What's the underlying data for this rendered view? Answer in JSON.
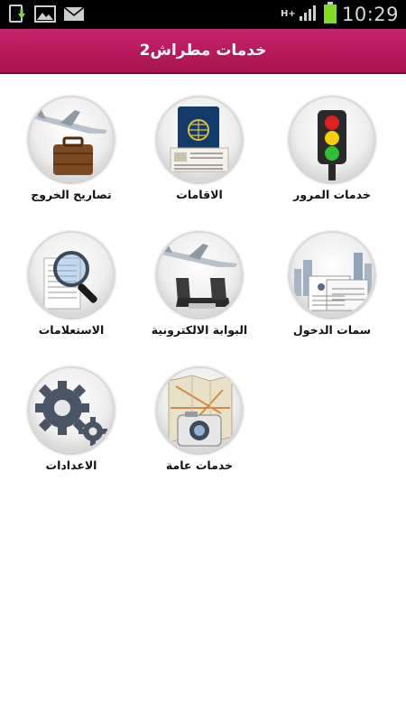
{
  "status_bar": {
    "time": "10:29",
    "network": "H+",
    "icons": [
      "download-icon",
      "gallery-icon",
      "mail-icon",
      "signal-icon",
      "battery-icon"
    ]
  },
  "header": {
    "title": "خدمات مطراش2"
  },
  "colors": {
    "header": "#b4185a",
    "battery": "#7fdc1e"
  },
  "grid": {
    "items": [
      {
        "label": "خدمات المرور",
        "icon": "traffic-light-icon"
      },
      {
        "label": "الاقامات",
        "icon": "passport-icon"
      },
      {
        "label": "تصاريح الخروج",
        "icon": "airplane-luggage-icon"
      },
      {
        "label": "سمات الدخول",
        "icon": "visa-document-icon"
      },
      {
        "label": "البوابة الالكترونية",
        "icon": "airplane-seat-icon"
      },
      {
        "label": "الاستعلامات",
        "icon": "magnifier-icon"
      },
      {
        "label": "خدمات عامة",
        "icon": "map-camera-icon"
      },
      {
        "label": "الاعدادات",
        "icon": "gears-icon"
      }
    ]
  }
}
